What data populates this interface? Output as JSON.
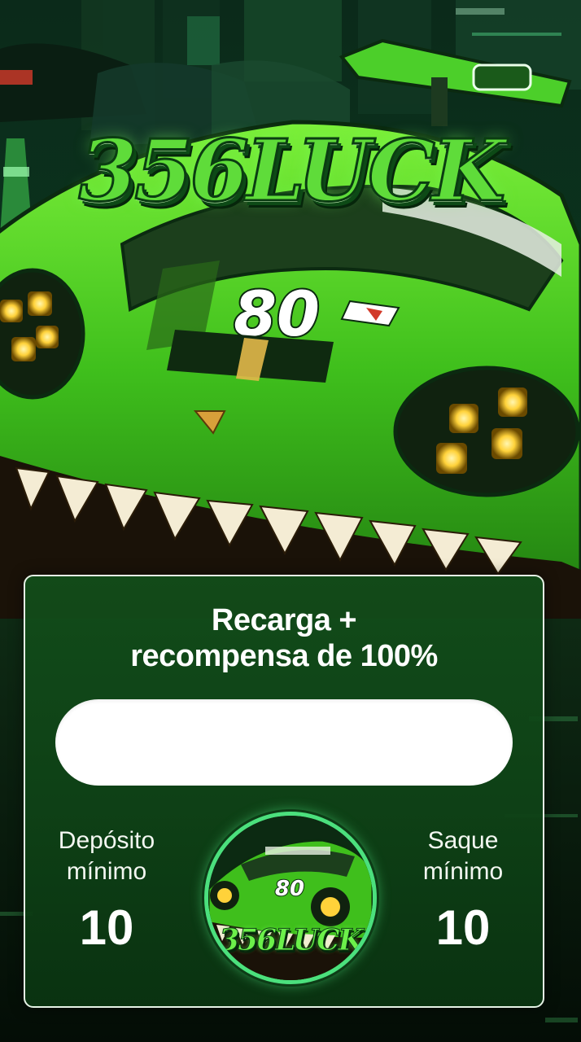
{
  "brand": {
    "title": "356LUCK"
  },
  "car": {
    "race_number": "80"
  },
  "promo": {
    "headline_line1": "Recarga +",
    "headline_line2": "recompensa de 100%",
    "code_field_value": "",
    "min_deposit_label_line1": "Depósito",
    "min_deposit_label_line2": "mínimo",
    "min_deposit_value": "10",
    "min_withdraw_label_line1": "Saque",
    "min_withdraw_label_line2": "mínimo",
    "min_withdraw_value": "10"
  },
  "badge": {
    "race_number": "80",
    "brand_text": "356LUCK"
  },
  "colors": {
    "accent_green": "#5fdc3a",
    "card_green": "#124e1a",
    "badge_ring": "#4be07d",
    "headlight": "#ffd23a"
  }
}
